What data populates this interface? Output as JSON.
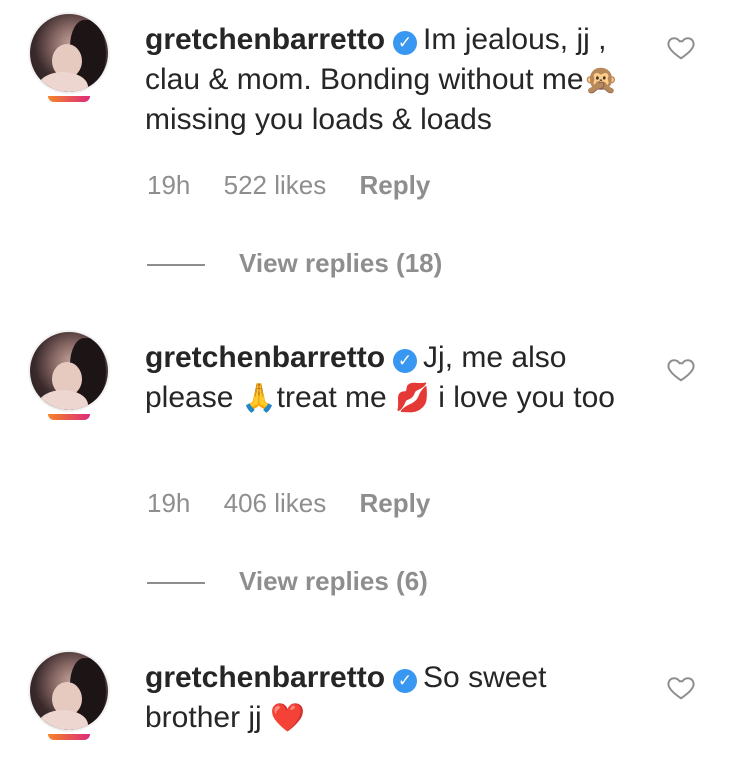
{
  "comments": [
    {
      "username": "gretchenbarretto",
      "text_parts": [
        "Im jealous, jj , clau & mom. Bonding without me",
        "🙊",
        " missing you loads & loads"
      ],
      "time": "19h",
      "likes": "522 likes",
      "reply": "Reply",
      "view_replies": "View replies (18)"
    },
    {
      "username": "gretchenbarretto",
      "text_parts": [
        "Jj, me also please ",
        "🙏",
        "treat me ",
        "💋",
        " i love you too"
      ],
      "time": "19h",
      "likes": "406 likes",
      "reply": "Reply",
      "view_replies": "View replies (6)"
    },
    {
      "username": "gretchenbarretto",
      "text_parts": [
        "So sweet brother jj ",
        "❤️"
      ]
    }
  ],
  "icons": {
    "verified": "verified-badge-icon",
    "like": "heart-outline-icon",
    "accent": "#3897f0",
    "muted": "#8e8e8e"
  }
}
